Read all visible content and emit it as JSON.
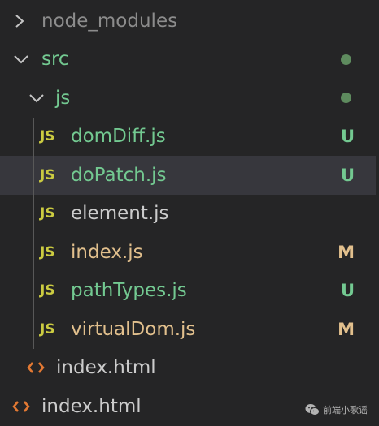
{
  "colors": {
    "background": "#252526",
    "selected_row": "#37373d",
    "untracked": "#73c991",
    "modified": "#e2c08d",
    "default_text": "#cccccc",
    "ignored_text": "#8c8c8c",
    "js_badge": "#cbcb41",
    "html_icon": "#e37933",
    "untracked_dot": "#5e8b5e"
  },
  "explorer": {
    "node_modules": {
      "label": "node_modules",
      "icon": "chevron-right-icon"
    },
    "src": {
      "label": "src",
      "icon": "chevron-down-icon"
    },
    "js": {
      "label": "js",
      "icon": "chevron-down-icon"
    },
    "files": [
      {
        "label": "domDiff.js",
        "badge": "JS",
        "status": "U"
      },
      {
        "label": "doPatch.js",
        "badge": "JS",
        "status": "U"
      },
      {
        "label": "element.js",
        "badge": "JS",
        "status": ""
      },
      {
        "label": "index.js",
        "badge": "JS",
        "status": "M"
      },
      {
        "label": "pathTypes.js",
        "badge": "JS",
        "status": "U"
      },
      {
        "label": "virtualDom.js",
        "badge": "JS",
        "status": "M"
      }
    ],
    "src_index_html": {
      "label": "index.html",
      "icon": "html-code-icon"
    },
    "root_index_html": {
      "label": "index.html",
      "icon": "html-code-icon"
    }
  },
  "watermark": {
    "text": "前端小歌谣",
    "icon": "wechat-icon"
  }
}
